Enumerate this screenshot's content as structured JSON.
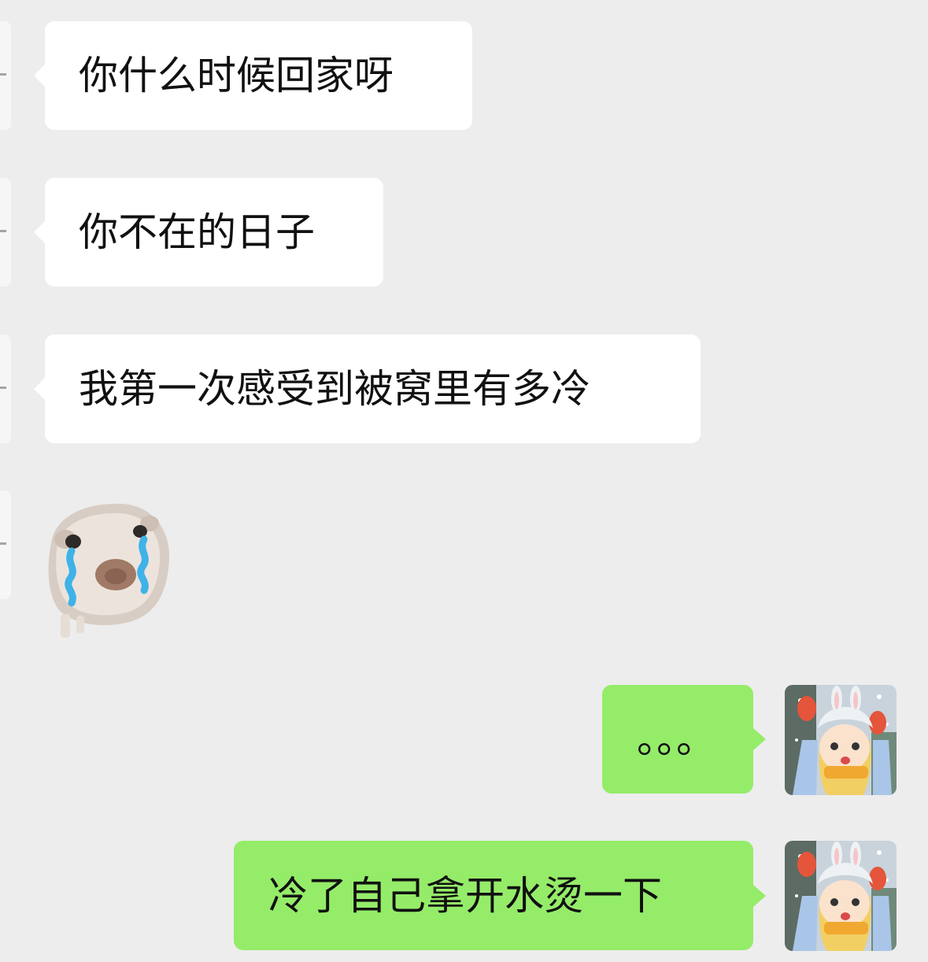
{
  "colors": {
    "background": "#ededed",
    "incoming_bubble": "#ffffff",
    "outgoing_bubble": "#95ec69",
    "text": "#111111"
  },
  "messages": [
    {
      "side": "left",
      "type": "text",
      "text": "你什么时候回家呀"
    },
    {
      "side": "left",
      "type": "text",
      "text": "你不在的日子"
    },
    {
      "side": "left",
      "type": "text",
      "text": "我第一次感受到被窝里有多冷"
    },
    {
      "side": "left",
      "type": "sticker",
      "icon": "crying-hamster-sticker"
    },
    {
      "side": "right",
      "type": "text",
      "text": "。。。"
    },
    {
      "side": "right",
      "type": "text",
      "text": "冷了自己拿开水烫一下"
    }
  ],
  "avatars": {
    "contact": "contact-avatar",
    "self": "anime-girl-avatar"
  }
}
